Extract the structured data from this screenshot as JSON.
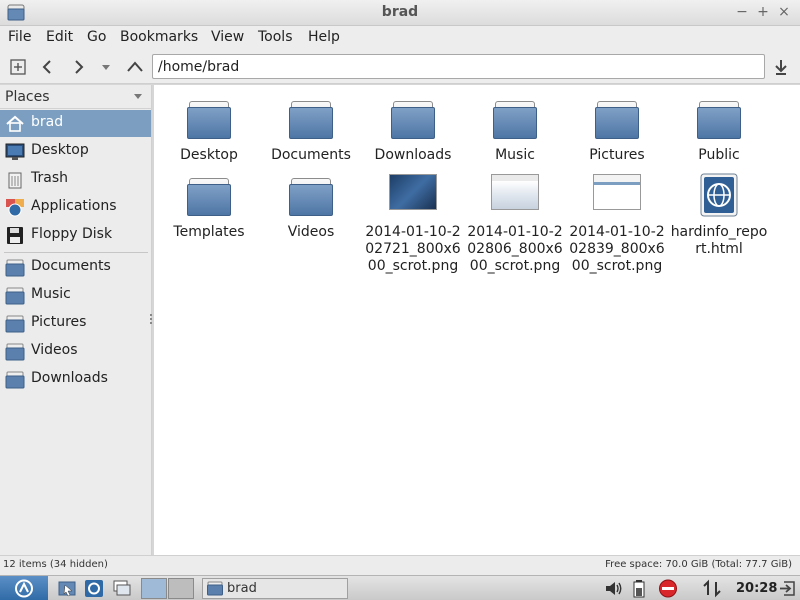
{
  "window": {
    "title": "brad"
  },
  "menu": [
    "File",
    "Edit",
    "Go",
    "Bookmarks",
    "View",
    "Tools",
    "Help"
  ],
  "location": {
    "path": "/home/brad"
  },
  "sidebar": {
    "header": "Places",
    "places": [
      {
        "label": "brad",
        "icon": "home-icon",
        "selected": true
      },
      {
        "label": "Desktop",
        "icon": "desktop-icon"
      },
      {
        "label": "Trash",
        "icon": "trash-icon"
      },
      {
        "label": "Applications",
        "icon": "applications-icon"
      },
      {
        "label": "Floppy Disk",
        "icon": "floppy-icon"
      }
    ],
    "bookmarks": [
      {
        "label": "Documents",
        "icon": "folder-icon"
      },
      {
        "label": "Music",
        "icon": "folder-icon"
      },
      {
        "label": "Pictures",
        "icon": "folder-icon"
      },
      {
        "label": "Videos",
        "icon": "folder-icon"
      },
      {
        "label": "Downloads",
        "icon": "folder-icon"
      }
    ]
  },
  "files": [
    {
      "name": "Desktop",
      "type": "folder"
    },
    {
      "name": "Documents",
      "type": "folder"
    },
    {
      "name": "Downloads",
      "type": "folder"
    },
    {
      "name": "Music",
      "type": "folder"
    },
    {
      "name": "Pictures",
      "type": "folder"
    },
    {
      "name": "Public",
      "type": "folder"
    },
    {
      "name": "Templates",
      "type": "folder"
    },
    {
      "name": "Videos",
      "type": "folder"
    },
    {
      "name": "2014-01-10-202721_800x600_scrot.png",
      "type": "image"
    },
    {
      "name": "2014-01-10-202806_800x600_scrot.png",
      "type": "image"
    },
    {
      "name": "2014-01-10-202839_800x600_scrot.png",
      "type": "image"
    },
    {
      "name": "hardinfo_report.html",
      "type": "html"
    }
  ],
  "status": {
    "items": "12 items (34 hidden)",
    "free_space": "Free space: 70.0 GiB (Total: 77.7 GiB)"
  },
  "taskbar": {
    "task_label": "brad",
    "clock": "20:28"
  },
  "colors": {
    "selection": "#7c9fc1",
    "folder": "#5b80ad"
  }
}
